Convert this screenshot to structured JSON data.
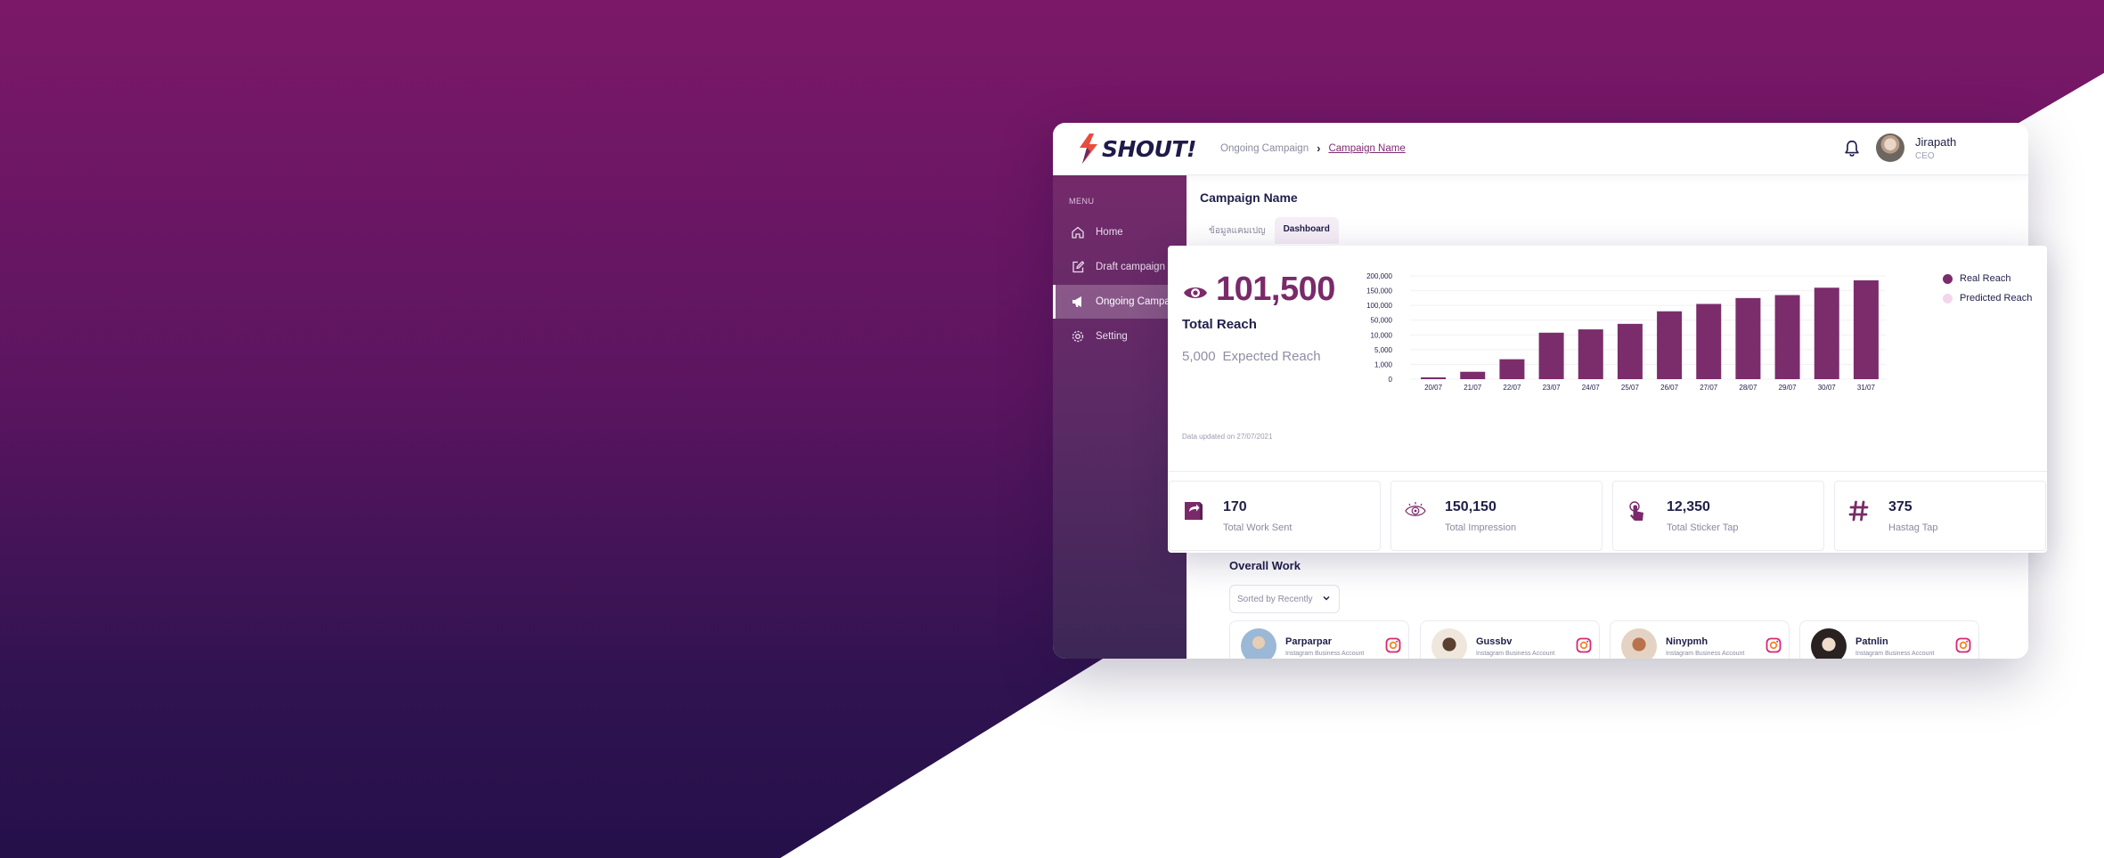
{
  "app": {
    "brand": "SHOUT!",
    "breadcrumb": [
      "Ongoing Campaign",
      "Campaign Name"
    ],
    "user": {
      "name": "Jirapath",
      "role": "CEO"
    }
  },
  "sidebar": {
    "title": "MENU",
    "items": [
      {
        "label": "Home",
        "icon": "home-icon"
      },
      {
        "label": "Draft campaign",
        "icon": "edit-icon"
      },
      {
        "label": "Ongoing Campaign",
        "icon": "megaphone-icon",
        "active": true
      },
      {
        "label": "Setting",
        "icon": "gear-icon"
      }
    ]
  },
  "main": {
    "title": "Campaign Name",
    "tabs": [
      "ข้อมูลแคมเปญ",
      "Dashboard"
    ],
    "active_tab": "Dashboard"
  },
  "dashboard": {
    "total_reach": "101,500",
    "total_reach_label": "Total Reach",
    "expected_value": "5,000",
    "expected_label": "Expected Reach",
    "updated": "Data updated on 27/07/2021",
    "stats": [
      {
        "value": "170",
        "label": "Total Work Sent",
        "icon": "share-icon"
      },
      {
        "value": "150,150",
        "label": "Total Impression",
        "icon": "eye-icon"
      },
      {
        "value": "12,350",
        "label": "Total Sticker Tap",
        "icon": "tap-icon"
      },
      {
        "value": "375",
        "label": "Hastag Tap",
        "icon": "hashtag-icon"
      }
    ]
  },
  "chart_data": {
    "type": "bar",
    "categories": [
      "20/07",
      "21/07",
      "22/07",
      "23/07",
      "24/07",
      "25/07",
      "26/07",
      "27/07",
      "28/07",
      "29/07",
      "30/07",
      "31/07"
    ],
    "series": [
      {
        "name": "Real Reach",
        "values": [
          0,
          500,
          2400,
          16000,
          25000,
          40000,
          80000,
          105000,
          125000,
          135000,
          160000,
          185000
        ]
      },
      {
        "name": "Predicted Reach",
        "values": []
      }
    ],
    "yticks": [
      "0",
      "1,000",
      "5,000",
      "10,000",
      "50,000",
      "100,000",
      "150,000",
      "200,000"
    ],
    "ytick_values": [
      0,
      1000,
      5000,
      10000,
      50000,
      100000,
      150000,
      200000
    ],
    "colors": {
      "Real Reach": "#7b2d6b",
      "Predicted Reach": "#f3d6ec"
    },
    "legend_position": "top-right",
    "grid": true
  },
  "overall": {
    "title": "Overall Work",
    "sort_label": "Sorted by Recently",
    "cards": [
      {
        "name": "Parparpar",
        "sub": "Instagram Business Account"
      },
      {
        "name": "Gussbv",
        "sub": "Instagram Business Account"
      },
      {
        "name": "Ninypmh",
        "sub": "Instagram Business Account"
      },
      {
        "name": "Patnlin",
        "sub": "Instagram Business Account"
      }
    ]
  },
  "colors": {
    "accent": "#7a2a6a",
    "navy": "#1f1f4a"
  }
}
